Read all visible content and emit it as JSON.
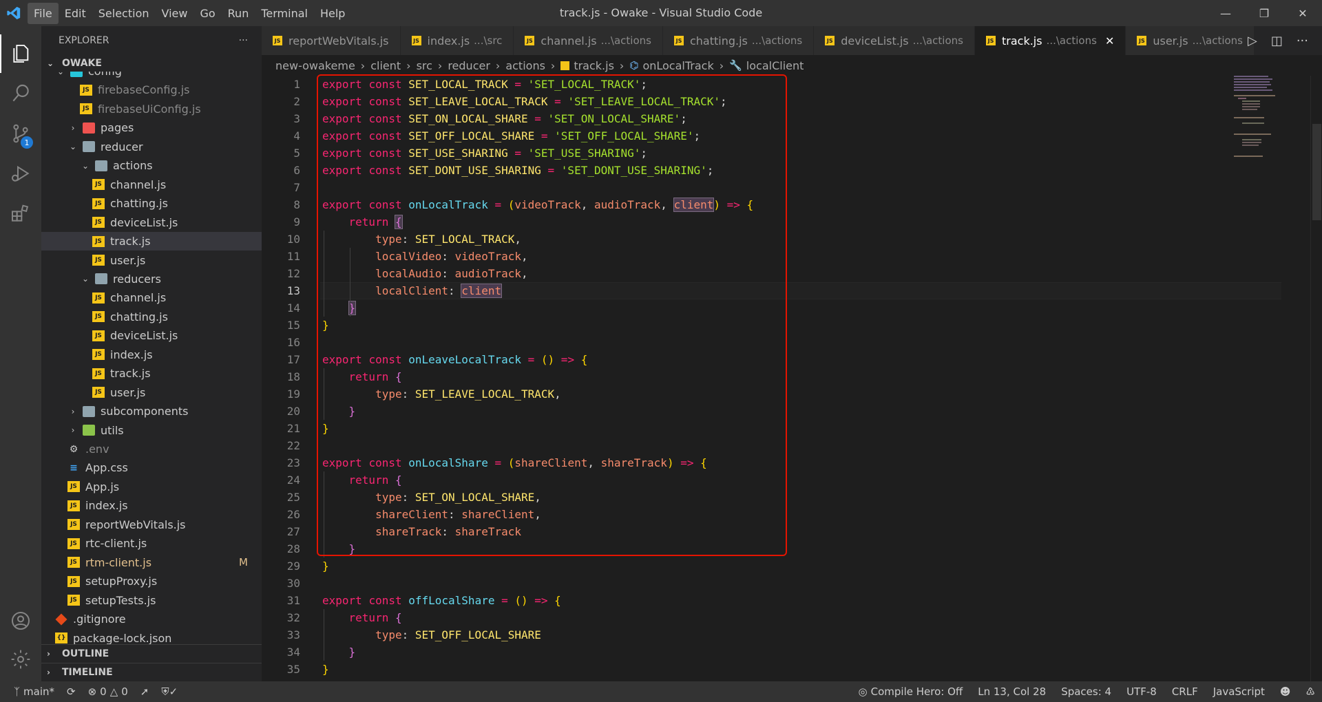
{
  "window": {
    "title": "track.js - Owake - Visual Studio Code",
    "menu": [
      "File",
      "Edit",
      "Selection",
      "View",
      "Go",
      "Run",
      "Terminal",
      "Help"
    ]
  },
  "activity": {
    "scm_badge": "1"
  },
  "sidebar": {
    "header": "EXPLORER",
    "root": "OWAKE",
    "rows": [
      {
        "label": "config",
        "type": "folder-cyan",
        "indent": 1,
        "chev": "⌄"
      },
      {
        "label": "firebaseConfig.js",
        "type": "js",
        "indent": 3,
        "dim": true
      },
      {
        "label": "firebaseUiConfig.js",
        "type": "js",
        "indent": 3,
        "dim": true
      },
      {
        "label": "pages",
        "type": "folder-red",
        "indent": 2,
        "chev": "›"
      },
      {
        "label": "reducer",
        "type": "folder",
        "indent": 2,
        "chev": "⌄"
      },
      {
        "label": "actions",
        "type": "folder",
        "indent": 3,
        "chev": "⌄"
      },
      {
        "label": "channel.js",
        "type": "js",
        "indent": 4
      },
      {
        "label": "chatting.js",
        "type": "js",
        "indent": 4
      },
      {
        "label": "deviceList.js",
        "type": "js",
        "indent": 4
      },
      {
        "label": "track.js",
        "type": "js",
        "indent": 4,
        "selected": true
      },
      {
        "label": "user.js",
        "type": "js",
        "indent": 4
      },
      {
        "label": "reducers",
        "type": "folder",
        "indent": 3,
        "chev": "⌄"
      },
      {
        "label": "channel.js",
        "type": "js",
        "indent": 4
      },
      {
        "label": "chatting.js",
        "type": "js",
        "indent": 4
      },
      {
        "label": "deviceList.js",
        "type": "js",
        "indent": 4
      },
      {
        "label": "index.js",
        "type": "js",
        "indent": 4
      },
      {
        "label": "track.js",
        "type": "js",
        "indent": 4
      },
      {
        "label": "user.js",
        "type": "js",
        "indent": 4
      },
      {
        "label": "subcomponents",
        "type": "folder",
        "indent": 2,
        "chev": "›"
      },
      {
        "label": "utils",
        "type": "folder-green",
        "indent": 2,
        "chev": "›"
      },
      {
        "label": ".env",
        "type": "env",
        "indent": 2,
        "dim": true
      },
      {
        "label": "App.css",
        "type": "css",
        "indent": 2
      },
      {
        "label": "App.js",
        "type": "js",
        "indent": 2
      },
      {
        "label": "index.js",
        "type": "js",
        "indent": 2
      },
      {
        "label": "reportWebVitals.js",
        "type": "js",
        "indent": 2
      },
      {
        "label": "rtc-client.js",
        "type": "js",
        "indent": 2
      },
      {
        "label": "rtm-client.js",
        "type": "js",
        "indent": 2,
        "modified": true,
        "flag": "M"
      },
      {
        "label": "setupProxy.js",
        "type": "js",
        "indent": 2
      },
      {
        "label": "setupTests.js",
        "type": "js",
        "indent": 2
      },
      {
        "label": ".gitignore",
        "type": "git",
        "indent": 1
      },
      {
        "label": "package-lock.json",
        "type": "json",
        "indent": 1
      }
    ],
    "outline": "OUTLINE",
    "timeline": "TIMELINE"
  },
  "tabs": [
    {
      "name": "reportWebVitals.js",
      "desc": ""
    },
    {
      "name": "index.js",
      "desc": "...\\src"
    },
    {
      "name": "channel.js",
      "desc": "...\\actions"
    },
    {
      "name": "chatting.js",
      "desc": "...\\actions"
    },
    {
      "name": "deviceList.js",
      "desc": "...\\actions"
    },
    {
      "name": "track.js",
      "desc": "...\\actions",
      "active": true
    },
    {
      "name": "user.js",
      "desc": "...\\actions"
    }
  ],
  "breadcrumb": [
    "new-owakeme",
    "client",
    "src",
    "reducer",
    "actions",
    "track.js",
    "onLocalTrack",
    "localClient"
  ],
  "editor": {
    "current_line": 13,
    "lines": [
      [
        [
          "k",
          "export "
        ],
        [
          "k",
          "const "
        ],
        [
          "c",
          "SET_LOCAL_TRACK"
        ],
        [
          "o",
          " = "
        ],
        [
          "s",
          "'SET_LOCAL_TRACK'"
        ],
        [
          "punc",
          ";"
        ]
      ],
      [
        [
          "k",
          "export "
        ],
        [
          "k",
          "const "
        ],
        [
          "c",
          "SET_LEAVE_LOCAL_TRACK"
        ],
        [
          "o",
          " = "
        ],
        [
          "s",
          "'SET_LEAVE_LOCAL_TRACK'"
        ],
        [
          "punc",
          ";"
        ]
      ],
      [
        [
          "k",
          "export "
        ],
        [
          "k",
          "const "
        ],
        [
          "c",
          "SET_ON_LOCAL_SHARE"
        ],
        [
          "o",
          " = "
        ],
        [
          "s",
          "'SET_ON_LOCAL_SHARE'"
        ],
        [
          "punc",
          ";"
        ]
      ],
      [
        [
          "k",
          "export "
        ],
        [
          "k",
          "const "
        ],
        [
          "c",
          "SET_OFF_LOCAL_SHARE"
        ],
        [
          "o",
          " = "
        ],
        [
          "s",
          "'SET_OFF_LOCAL_SHARE'"
        ],
        [
          "punc",
          ";"
        ]
      ],
      [
        [
          "k",
          "export "
        ],
        [
          "k",
          "const "
        ],
        [
          "c",
          "SET_USE_SHARING"
        ],
        [
          "o",
          " = "
        ],
        [
          "s",
          "'SET_USE_SHARING'"
        ],
        [
          "punc",
          ";"
        ]
      ],
      [
        [
          "k",
          "export "
        ],
        [
          "k",
          "const "
        ],
        [
          "c",
          "SET_DONT_USE_SHARING"
        ],
        [
          "o",
          " = "
        ],
        [
          "s",
          "'SET_DONT_USE_SHARING'"
        ],
        [
          "punc",
          ";"
        ]
      ],
      [],
      [
        [
          "k",
          "export "
        ],
        [
          "k",
          "const "
        ],
        [
          "f",
          "onLocalTrack"
        ],
        [
          "o",
          " = "
        ],
        [
          "b1",
          "("
        ],
        [
          "pr",
          "videoTrack"
        ],
        [
          "punc",
          ", "
        ],
        [
          "pr",
          "audioTrack"
        ],
        [
          "punc",
          ", "
        ],
        [
          "pr hl",
          "client"
        ],
        [
          "b1",
          ")"
        ],
        [
          "o",
          " => "
        ],
        [
          "b1",
          "{"
        ]
      ],
      [
        [
          "punc",
          "    "
        ],
        [
          "k",
          "return "
        ],
        [
          "b2 hl",
          "{"
        ]
      ],
      [
        [
          "punc",
          "        "
        ],
        [
          "pr",
          "type"
        ],
        [
          "punc",
          ": "
        ],
        [
          "c",
          "SET_LOCAL_TRACK"
        ],
        [
          "punc",
          ","
        ]
      ],
      [
        [
          "punc",
          "        "
        ],
        [
          "pr",
          "localVideo"
        ],
        [
          "punc",
          ": "
        ],
        [
          "pr",
          "videoTrack"
        ],
        [
          "punc",
          ","
        ]
      ],
      [
        [
          "punc",
          "        "
        ],
        [
          "pr",
          "localAudio"
        ],
        [
          "punc",
          ": "
        ],
        [
          "pr",
          "audioTrack"
        ],
        [
          "punc",
          ","
        ]
      ],
      [
        [
          "punc",
          "        "
        ],
        [
          "pr",
          "localClient"
        ],
        [
          "punc",
          ": "
        ],
        [
          "pr hl",
          "client"
        ]
      ],
      [
        [
          "punc",
          "    "
        ],
        [
          "b2 hl",
          "}"
        ]
      ],
      [
        [
          "b1",
          "}"
        ]
      ],
      [],
      [
        [
          "k",
          "export "
        ],
        [
          "k",
          "const "
        ],
        [
          "f",
          "onLeaveLocalTrack"
        ],
        [
          "o",
          " = "
        ],
        [
          "b1",
          "()"
        ],
        [
          "o",
          " => "
        ],
        [
          "b1",
          "{"
        ]
      ],
      [
        [
          "punc",
          "    "
        ],
        [
          "k",
          "return "
        ],
        [
          "b2",
          "{"
        ]
      ],
      [
        [
          "punc",
          "        "
        ],
        [
          "pr",
          "type"
        ],
        [
          "punc",
          ": "
        ],
        [
          "c",
          "SET_LEAVE_LOCAL_TRACK"
        ],
        [
          "punc",
          ","
        ]
      ],
      [
        [
          "punc",
          "    "
        ],
        [
          "b2",
          "}"
        ]
      ],
      [
        [
          "b1",
          "}"
        ]
      ],
      [],
      [
        [
          "k",
          "export "
        ],
        [
          "k",
          "const "
        ],
        [
          "f",
          "onLocalShare"
        ],
        [
          "o",
          " = "
        ],
        [
          "b1",
          "("
        ],
        [
          "pr",
          "shareClient"
        ],
        [
          "punc",
          ", "
        ],
        [
          "pr",
          "shareTrack"
        ],
        [
          "b1",
          ")"
        ],
        [
          "o",
          " => "
        ],
        [
          "b1",
          "{"
        ]
      ],
      [
        [
          "punc",
          "    "
        ],
        [
          "k",
          "return "
        ],
        [
          "b2",
          "{"
        ]
      ],
      [
        [
          "punc",
          "        "
        ],
        [
          "pr",
          "type"
        ],
        [
          "punc",
          ": "
        ],
        [
          "c",
          "SET_ON_LOCAL_SHARE"
        ],
        [
          "punc",
          ","
        ]
      ],
      [
        [
          "punc",
          "        "
        ],
        [
          "pr",
          "shareClient"
        ],
        [
          "punc",
          ": "
        ],
        [
          "pr",
          "shareClient"
        ],
        [
          "punc",
          ","
        ]
      ],
      [
        [
          "punc",
          "        "
        ],
        [
          "pr",
          "shareTrack"
        ],
        [
          "punc",
          ": "
        ],
        [
          "pr",
          "shareTrack"
        ]
      ],
      [
        [
          "punc",
          "    "
        ],
        [
          "b2",
          "}"
        ]
      ],
      [
        [
          "b1",
          "}"
        ]
      ],
      [],
      [
        [
          "k",
          "export "
        ],
        [
          "k",
          "const "
        ],
        [
          "f",
          "offLocalShare"
        ],
        [
          "o",
          " = "
        ],
        [
          "b1",
          "()"
        ],
        [
          "o",
          " => "
        ],
        [
          "b1",
          "{"
        ]
      ],
      [
        [
          "punc",
          "    "
        ],
        [
          "k",
          "return "
        ],
        [
          "b2",
          "{"
        ]
      ],
      [
        [
          "punc",
          "        "
        ],
        [
          "pr",
          "type"
        ],
        [
          "punc",
          ": "
        ],
        [
          "c",
          "SET_OFF_LOCAL_SHARE"
        ]
      ],
      [
        [
          "punc",
          "    "
        ],
        [
          "b2",
          "}"
        ]
      ],
      [
        [
          "b1",
          "}"
        ]
      ]
    ]
  },
  "status": {
    "branch": "main*",
    "errors": "0",
    "warnings": "0",
    "compile_hero": "Compile Hero: Off",
    "position": "Ln 13, Col 28",
    "spaces": "Spaces: 4",
    "encoding": "UTF-8",
    "eol": "CRLF",
    "language": "JavaScript"
  }
}
